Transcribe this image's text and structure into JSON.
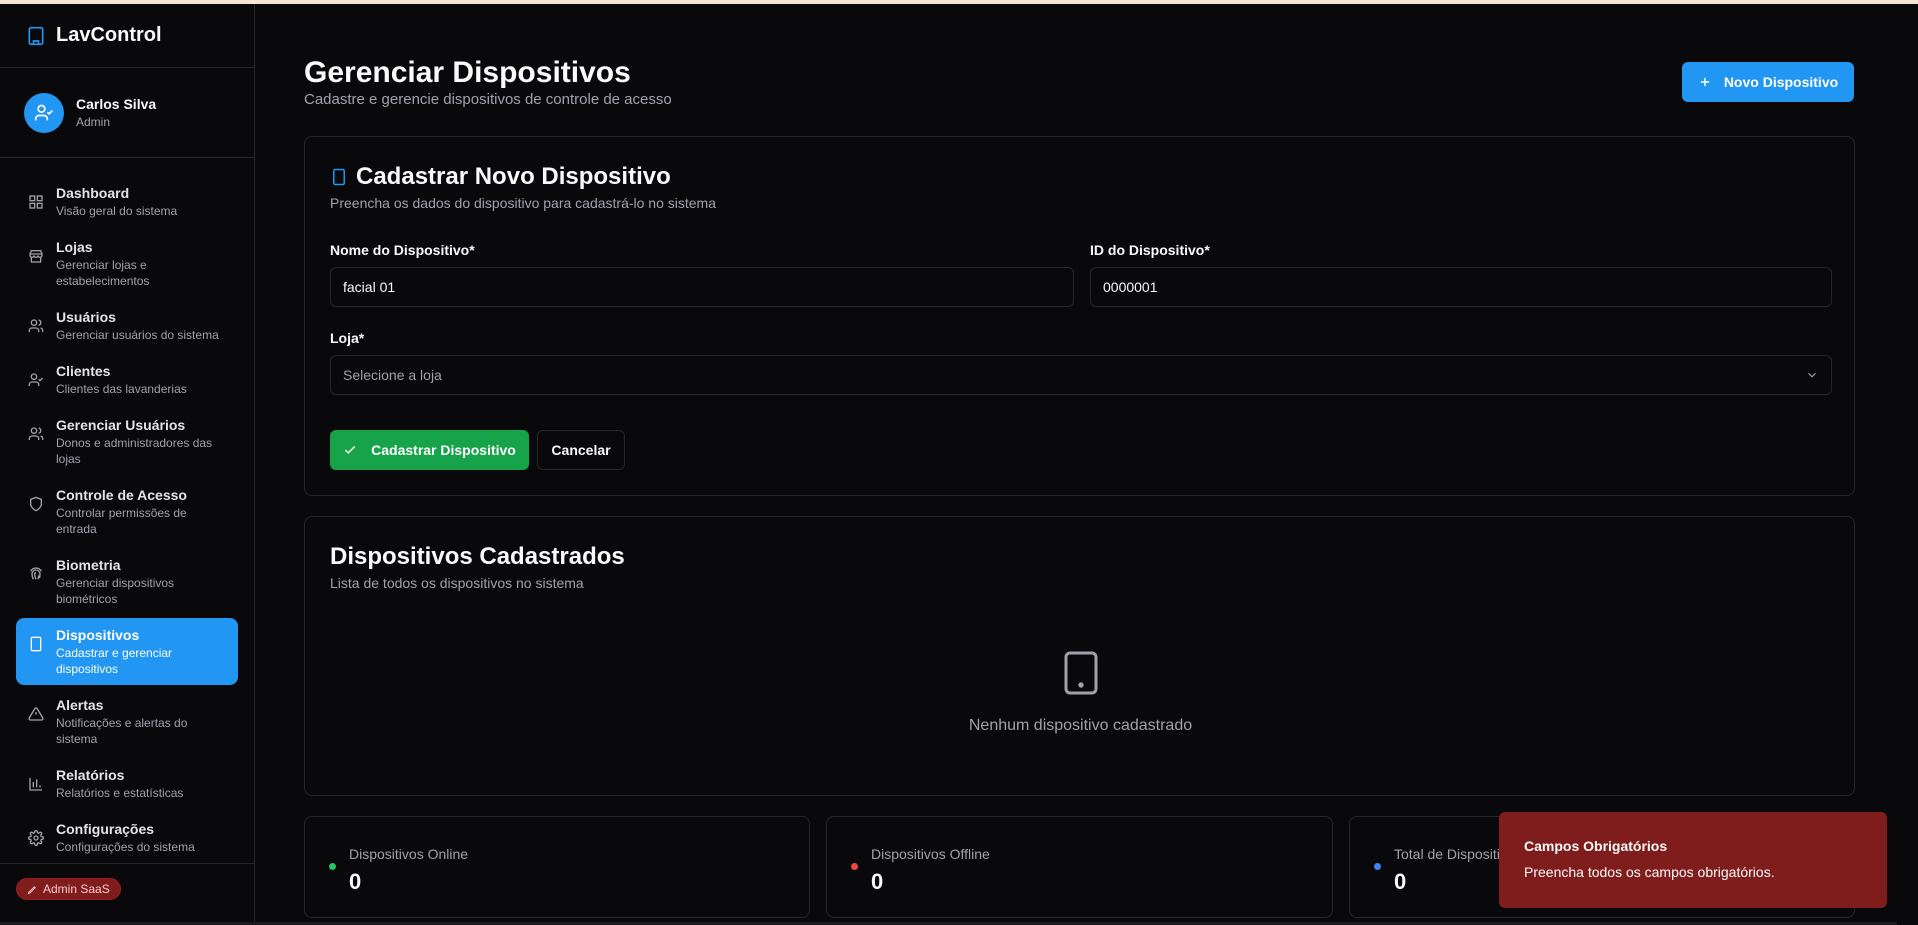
{
  "app": {
    "title": "LavControl"
  },
  "user": {
    "name": "Carlos Silva",
    "role": "Admin"
  },
  "sidebar": {
    "items": [
      {
        "title": "Dashboard",
        "sub": "Visão geral do sistema",
        "icon": "grid-icon"
      },
      {
        "title": "Lojas",
        "sub": "Gerenciar lojas e estabelecimentos",
        "icon": "store-icon"
      },
      {
        "title": "Usuários",
        "sub": "Gerenciar usuários do sistema",
        "icon": "users-icon"
      },
      {
        "title": "Clientes",
        "sub": "Clientes das lavanderias",
        "icon": "user-check-icon"
      },
      {
        "title": "Gerenciar Usuários",
        "sub": "Donos e administradores das lojas",
        "icon": "users-icon"
      },
      {
        "title": "Controle de Acesso",
        "sub": "Controlar permissões de entrada",
        "icon": "shield-icon"
      },
      {
        "title": "Biometria",
        "sub": "Gerenciar dispositivos biométricos",
        "icon": "fingerprint-icon"
      },
      {
        "title": "Dispositivos",
        "sub": "Cadastrar e gerenciar dispositivos",
        "icon": "tablet-icon"
      },
      {
        "title": "Alertas",
        "sub": "Notificações e alertas do sistema",
        "icon": "alert-triangle-icon"
      },
      {
        "title": "Relatórios",
        "sub": "Relatórios e estatísticas",
        "icon": "bar-chart-icon"
      },
      {
        "title": "Configurações",
        "sub": "Configurações do sistema",
        "icon": "gear-icon"
      }
    ],
    "footer_badge": "Admin SaaS"
  },
  "header": {
    "title": "Gerenciar Dispositivos",
    "subtitle": "Cadastre e gerencie dispositivos de controle de acesso",
    "new_button": "Novo Dispositivo"
  },
  "form": {
    "title": "Cadastrar Novo Dispositivo",
    "subtitle": "Preencha os dados do dispositivo para cadastrá-lo no sistema",
    "name_label": "Nome do Dispositivo*",
    "name_value": "facial 01",
    "id_label": "ID do Dispositivo*",
    "id_value": "0000001",
    "store_label": "Loja*",
    "store_placeholder": "Selecione a loja",
    "submit_label": "Cadastrar Dispositivo",
    "cancel_label": "Cancelar"
  },
  "list": {
    "title": "Dispositivos Cadastrados",
    "subtitle": "Lista de todos os dispositivos no sistema",
    "empty_text": "Nenhum dispositivo cadastrado"
  },
  "stats": [
    {
      "label": "Dispositivos Online",
      "value": "0",
      "color": "#22c55e"
    },
    {
      "label": "Dispositivos Offline",
      "value": "0",
      "color": "#ef4444"
    },
    {
      "label": "Total de Dispositivos",
      "value": "0",
      "color": "#3b82f6"
    }
  ],
  "toast": {
    "title": "Campos Obrigatórios",
    "text": "Preencha todos os campos obrigatórios."
  },
  "colors": {
    "accent": "#2196f3",
    "success": "#16a34a",
    "danger": "#7f1d1d"
  }
}
